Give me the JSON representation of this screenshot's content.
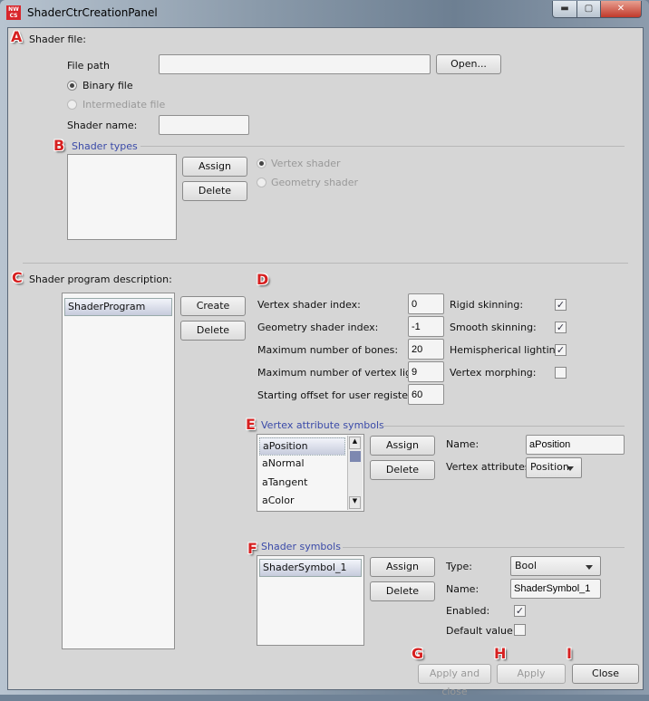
{
  "window": {
    "title": "ShaderCtrCreationPanel",
    "logo": "NW CS",
    "minimize": "minimize-icon",
    "maximize": "maximize-icon",
    "close": "close-icon"
  },
  "callouts": [
    "A",
    "B",
    "C",
    "D",
    "E",
    "F",
    "G",
    "H",
    "I"
  ],
  "shader_file": {
    "label": "Shader file:",
    "file_path_label": "File path",
    "file_path_value": "",
    "open_button": "Open...",
    "binary_label": "Binary file",
    "intermediate_label": "Intermediate file",
    "selected": "Binary file",
    "shader_name_label": "Shader name:",
    "shader_name_value": ""
  },
  "shader_types": {
    "label": "Shader types",
    "assign": "Assign",
    "delete": "Delete",
    "vertex_label": "Vertex shader",
    "geometry_label": "Geometry shader",
    "items": []
  },
  "program": {
    "label": "Shader program description:",
    "items": [
      "ShaderProgram"
    ],
    "create": "Create",
    "delete": "Delete"
  },
  "params": [
    {
      "label": "Vertex shader index:",
      "value": "0"
    },
    {
      "label": "Geometry shader index:",
      "value": "-1"
    },
    {
      "label": "Maximum number of bones:",
      "value": "20"
    },
    {
      "label": "Maximum number of vertex lights:",
      "value": "9"
    },
    {
      "label": "Starting offset for user registers",
      "value": "60"
    }
  ],
  "flags": [
    {
      "label": "Rigid skinning:",
      "checked": true
    },
    {
      "label": "Smooth skinning:",
      "checked": true
    },
    {
      "label": "Hemispherical lighting:",
      "checked": true
    },
    {
      "label": "Vertex morphing:",
      "checked": false
    }
  ],
  "vertex_attr": {
    "label": "Vertex attribute symbols",
    "items": [
      "aPosition",
      "aNormal",
      "aTangent",
      "aColor"
    ],
    "assign": "Assign",
    "delete": "Delete",
    "name_label": "Name:",
    "name_value": "aPosition",
    "attr_label": "Vertex attributes:",
    "attr_value": "Position"
  },
  "shader_symbols": {
    "label": "Shader symbols",
    "items": [
      "ShaderSymbol_1"
    ],
    "assign": "Assign",
    "delete": "Delete",
    "type_label": "Type:",
    "type_value": "Bool",
    "name_label": "Name:",
    "name_value": "ShaderSymbol_1",
    "enabled_label": "Enabled:",
    "enabled": true,
    "default_label": "Default value:",
    "default_value": false
  },
  "footer": {
    "apply_close": "Apply and close",
    "apply": "Apply",
    "close": "Close"
  },
  "check_mark": "✓"
}
